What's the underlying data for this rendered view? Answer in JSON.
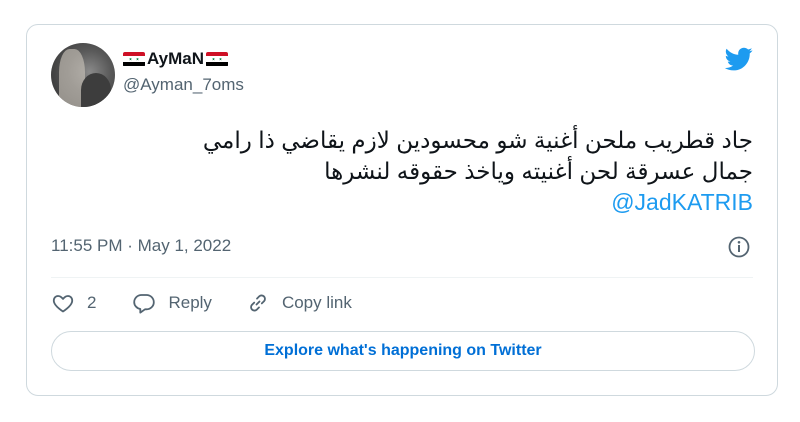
{
  "user": {
    "display_name": "AyMaN",
    "handle": "@Ayman_7oms"
  },
  "tweet": {
    "text_line1": "جاد قطريب ملحن أغنية شو محسودين لازم يقاضي ذا رامي",
    "text_line2": "جمال عسرقة لحن أغنيته وياخذ حقوقه لنشرها",
    "mention": "@JadKATRIB",
    "timestamp": "11:55 PM · May 1, 2022"
  },
  "actions": {
    "like_count": "2",
    "reply_label": "Reply",
    "copy_link_label": "Copy link"
  },
  "explore_label": "Explore what's happening on Twitter",
  "colors": {
    "brand_blue": "#1d9bf0",
    "link_blue": "#006fd6",
    "secondary_text": "#536471",
    "border": "#cfd9de"
  },
  "icons": [
    "syria-flag-icon",
    "twitter-bird-icon",
    "info-icon",
    "heart-icon",
    "reply-icon",
    "link-icon"
  ]
}
